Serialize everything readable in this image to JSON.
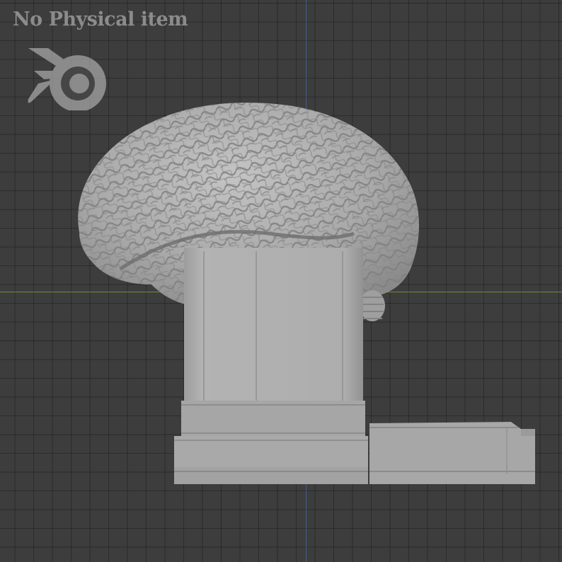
{
  "viewport": {
    "watermark_text": "No Physical item",
    "logo_icon": "blender-logo-icon",
    "background_color": "#3d3d3d",
    "grid_color": "#2f2f2f",
    "x_axis_color": "#6a8f2e",
    "y_axis_color": "#3f5f8f",
    "model_color": "#a8a8a8"
  }
}
